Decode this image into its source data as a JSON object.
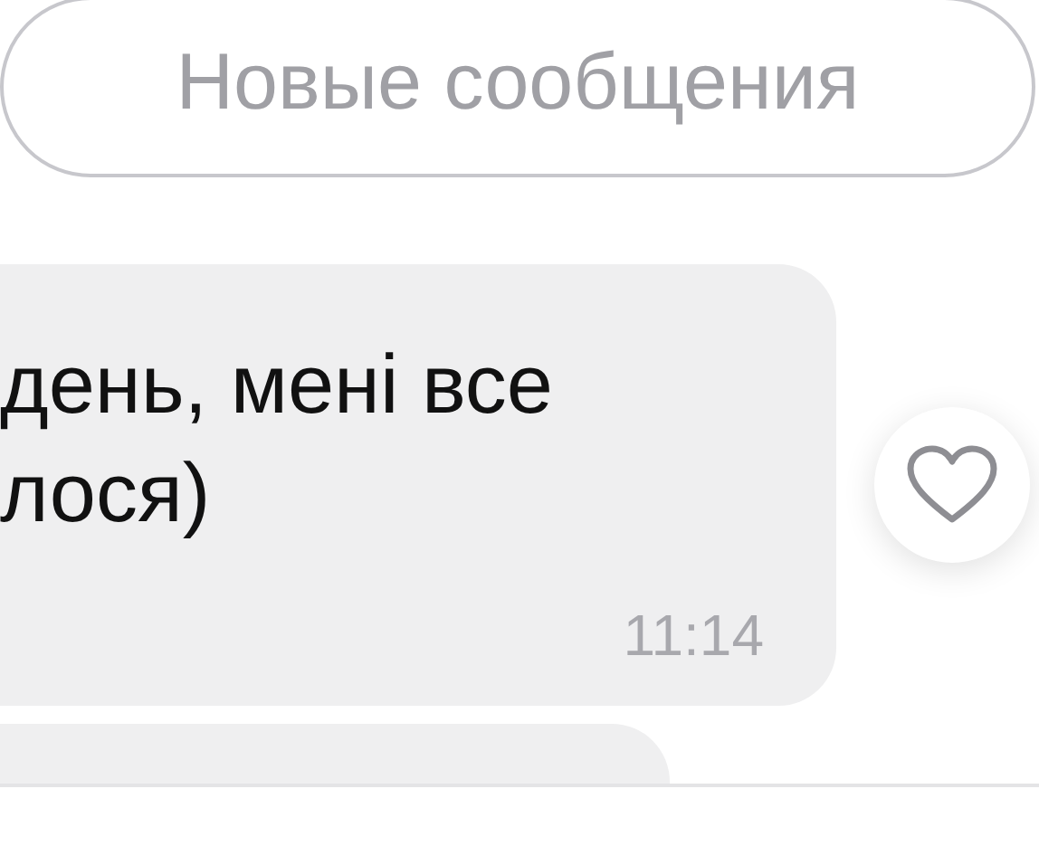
{
  "new_messages_button": {
    "label": "Новые сообщения"
  },
  "messages": [
    {
      "lines": [
        "день, мені все",
        "лося)"
      ],
      "time": "11:14",
      "liked": false
    }
  ]
}
